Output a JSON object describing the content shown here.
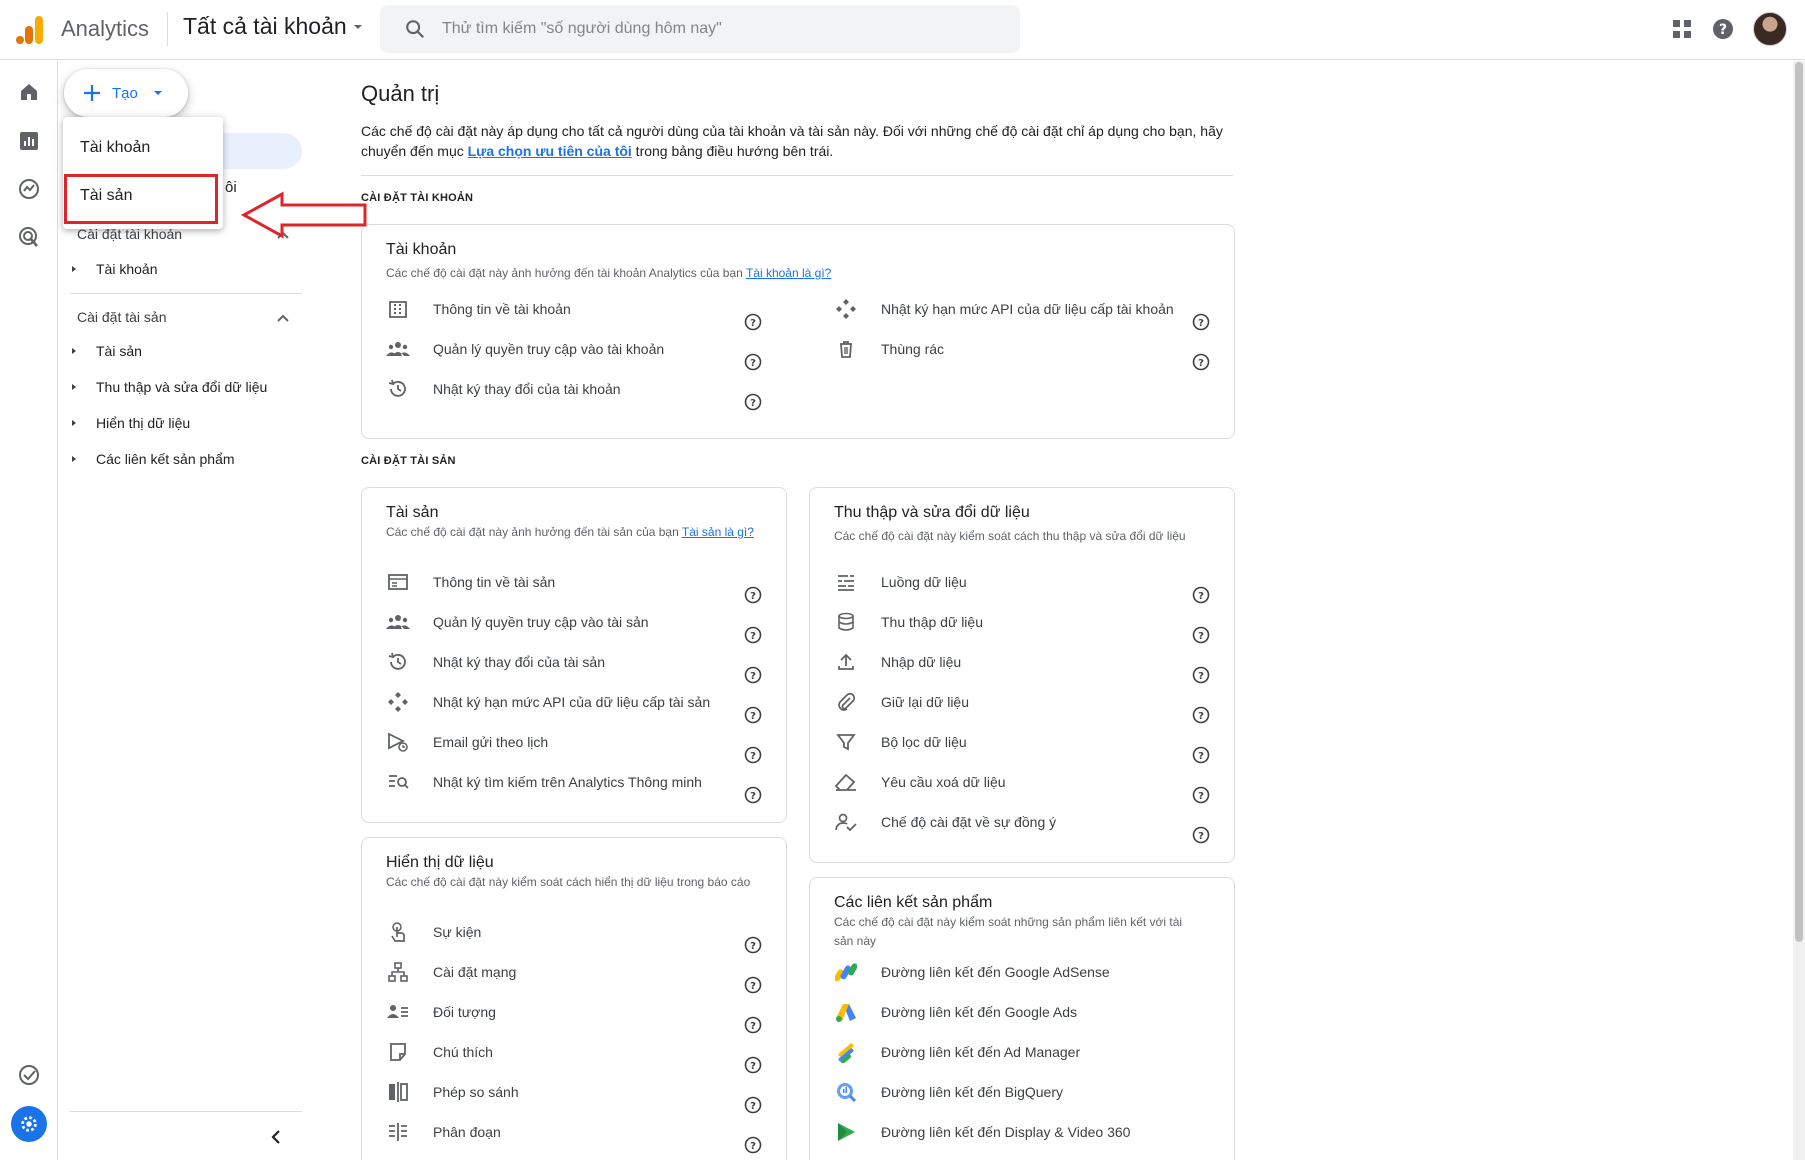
{
  "header": {
    "app_name": "Analytics",
    "account_picker": "Tất cả tài khoản",
    "search_placeholder": "Thử tìm kiếm \"số người dùng hôm nay\""
  },
  "create": {
    "label": "Tạo"
  },
  "dropdown": {
    "items": [
      "Tài khoản",
      "Tài sản"
    ]
  },
  "sidenav": {
    "partial_text": "ôi",
    "account_section": "Cài đặt tài khoản",
    "account_items": [
      "Tài khoản"
    ],
    "property_section": "Cài đặt tài sản",
    "property_items": [
      "Tài sản",
      "Thu thập và sửa đổi dữ liệu",
      "Hiển thị dữ liệu",
      "Các liên kết sản phẩm"
    ]
  },
  "main": {
    "title": "Quản trị",
    "desc_1": "Các chế độ cài đặt này áp dụng cho tất cả người dùng của tài khoản và tài sản này. Đối với những chế độ cài đặt chỉ áp dụng cho bạn, hãy chuyển đến mục ",
    "desc_link": "Lựa chọn ưu tiên của tôi",
    "desc_2": " trong bảng điều hướng bên trái.",
    "account_label": "CÀI ĐẶT TÀI KHOẢN",
    "property_label": "CÀI ĐẶT TÀI SẢN"
  },
  "account_card": {
    "title": "Tài khoản",
    "sub": "Các chế độ cài đặt này ảnh hưởng đến tài khoản Analytics của bạn ",
    "sub_link": "Tài khoản là gì?",
    "left_rows": [
      "Thông tin về tài khoản",
      "Quản lý quyền truy cập vào tài khoản",
      "Nhật ký thay đổi của tài khoản"
    ],
    "right_rows": [
      "Nhật ký hạn mức API của dữ liệu cấp tài khoản",
      "Thùng rác"
    ]
  },
  "property_card": {
    "title": "Tài sản",
    "sub": "Các chế độ cài đặt này ảnh hưởng đến tài sản của bạn ",
    "sub_link": "Tài sản là gì?",
    "rows": [
      "Thông tin về tài sản",
      "Quản lý quyền truy cập vào tài sản",
      "Nhật ký thay đổi của tài sản",
      "Nhật ký hạn mức API của dữ liệu cấp tài sản",
      "Email gửi theo lịch",
      "Nhật ký tìm kiếm trên Analytics Thông minh"
    ]
  },
  "collection_card": {
    "title": "Thu thập và sửa đổi dữ liệu",
    "sub": "Các chế độ cài đặt này kiểm soát cách thu thập và sửa đổi dữ liệu",
    "rows": [
      "Luồng dữ liệu",
      "Thu thập dữ liệu",
      "Nhập dữ liệu",
      "Giữ lại dữ liệu",
      "Bộ lọc dữ liệu",
      "Yêu cầu xoá dữ liệu",
      "Chế độ cài đặt về sự đồng ý"
    ]
  },
  "display_card": {
    "title": "Hiển thị dữ liệu",
    "sub": "Các chế độ cài đặt này kiểm soát cách hiển thị dữ liệu trong báo cáo",
    "rows": [
      "Sự kiện",
      "Cài đặt mạng",
      "Đối tượng",
      "Chú thích",
      "Phép so sánh",
      "Phân đoạn"
    ]
  },
  "links_card": {
    "title": "Các liên kết sản phẩm",
    "sub": "Các chế độ cài đặt này kiểm soát những sản phẩm liên kết với tài sản này",
    "rows": [
      "Đường liên kết đến Google AdSense",
      "Đường liên kết đến Google Ads",
      "Đường liên kết đến Ad Manager",
      "Đường liên kết đến BigQuery",
      "Đường liên kết đến Display & Video 360"
    ]
  },
  "colors": {
    "accent": "#1a73e8",
    "annotation_red": "#e0252a",
    "logo_orange": "#f9ab00",
    "logo_dark": "#e37400"
  }
}
